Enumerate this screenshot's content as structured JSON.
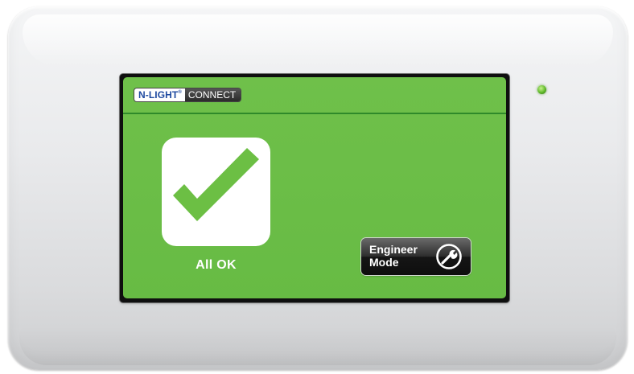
{
  "device": {
    "brand": "N-LIGHT",
    "trademark": "®",
    "product": "CONNECT",
    "led_color": "#5fb92a"
  },
  "screen": {
    "background_color": "#6fc04a",
    "status": {
      "icon": "checkmark-icon",
      "label": "All OK"
    },
    "engineer_mode": {
      "label": "Engineer\nMode",
      "icon": "wrench-icon"
    }
  }
}
